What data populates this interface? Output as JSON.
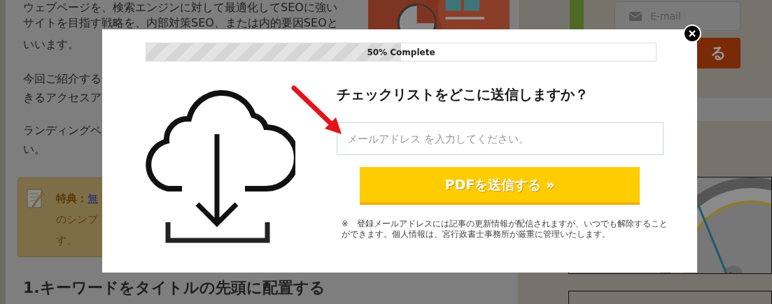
{
  "article": {
    "intro_lines": [
      "ウェブページを、検索エンジンに対して最適化してSEOに強い",
      "サイトを目指す戦略を、内部対策SEO、または内的要因SEOと",
      "いいます。"
    ],
    "second_lines": [
      "今回ご紹介する",
      "きるアクセスア"
    ],
    "third_lines": [
      "ランディングペ",
      "い。"
    ],
    "callout": {
      "label": "特典：",
      "link": "無",
      "lines": [
        "のシンプ",
        "す。"
      ]
    },
    "heading": "1.キーワードをタイトルの先頭に配置する"
  },
  "sidebar": {
    "email_placeholder": "E-mail",
    "button": "る"
  },
  "modal": {
    "progress": {
      "level": 0.5,
      "label": "50% Complete"
    },
    "title": "チェックリストをどこに送信しますか？",
    "email_placeholder": "メールアドレス を入力してください。",
    "submit": "PDFを送信する »",
    "note": "※　登録メールアドレスには記事の更新情報が配信されますが、いつでも解除することができます。個人情報は、宮行政書士事務所が厳重に管理いたします。"
  }
}
